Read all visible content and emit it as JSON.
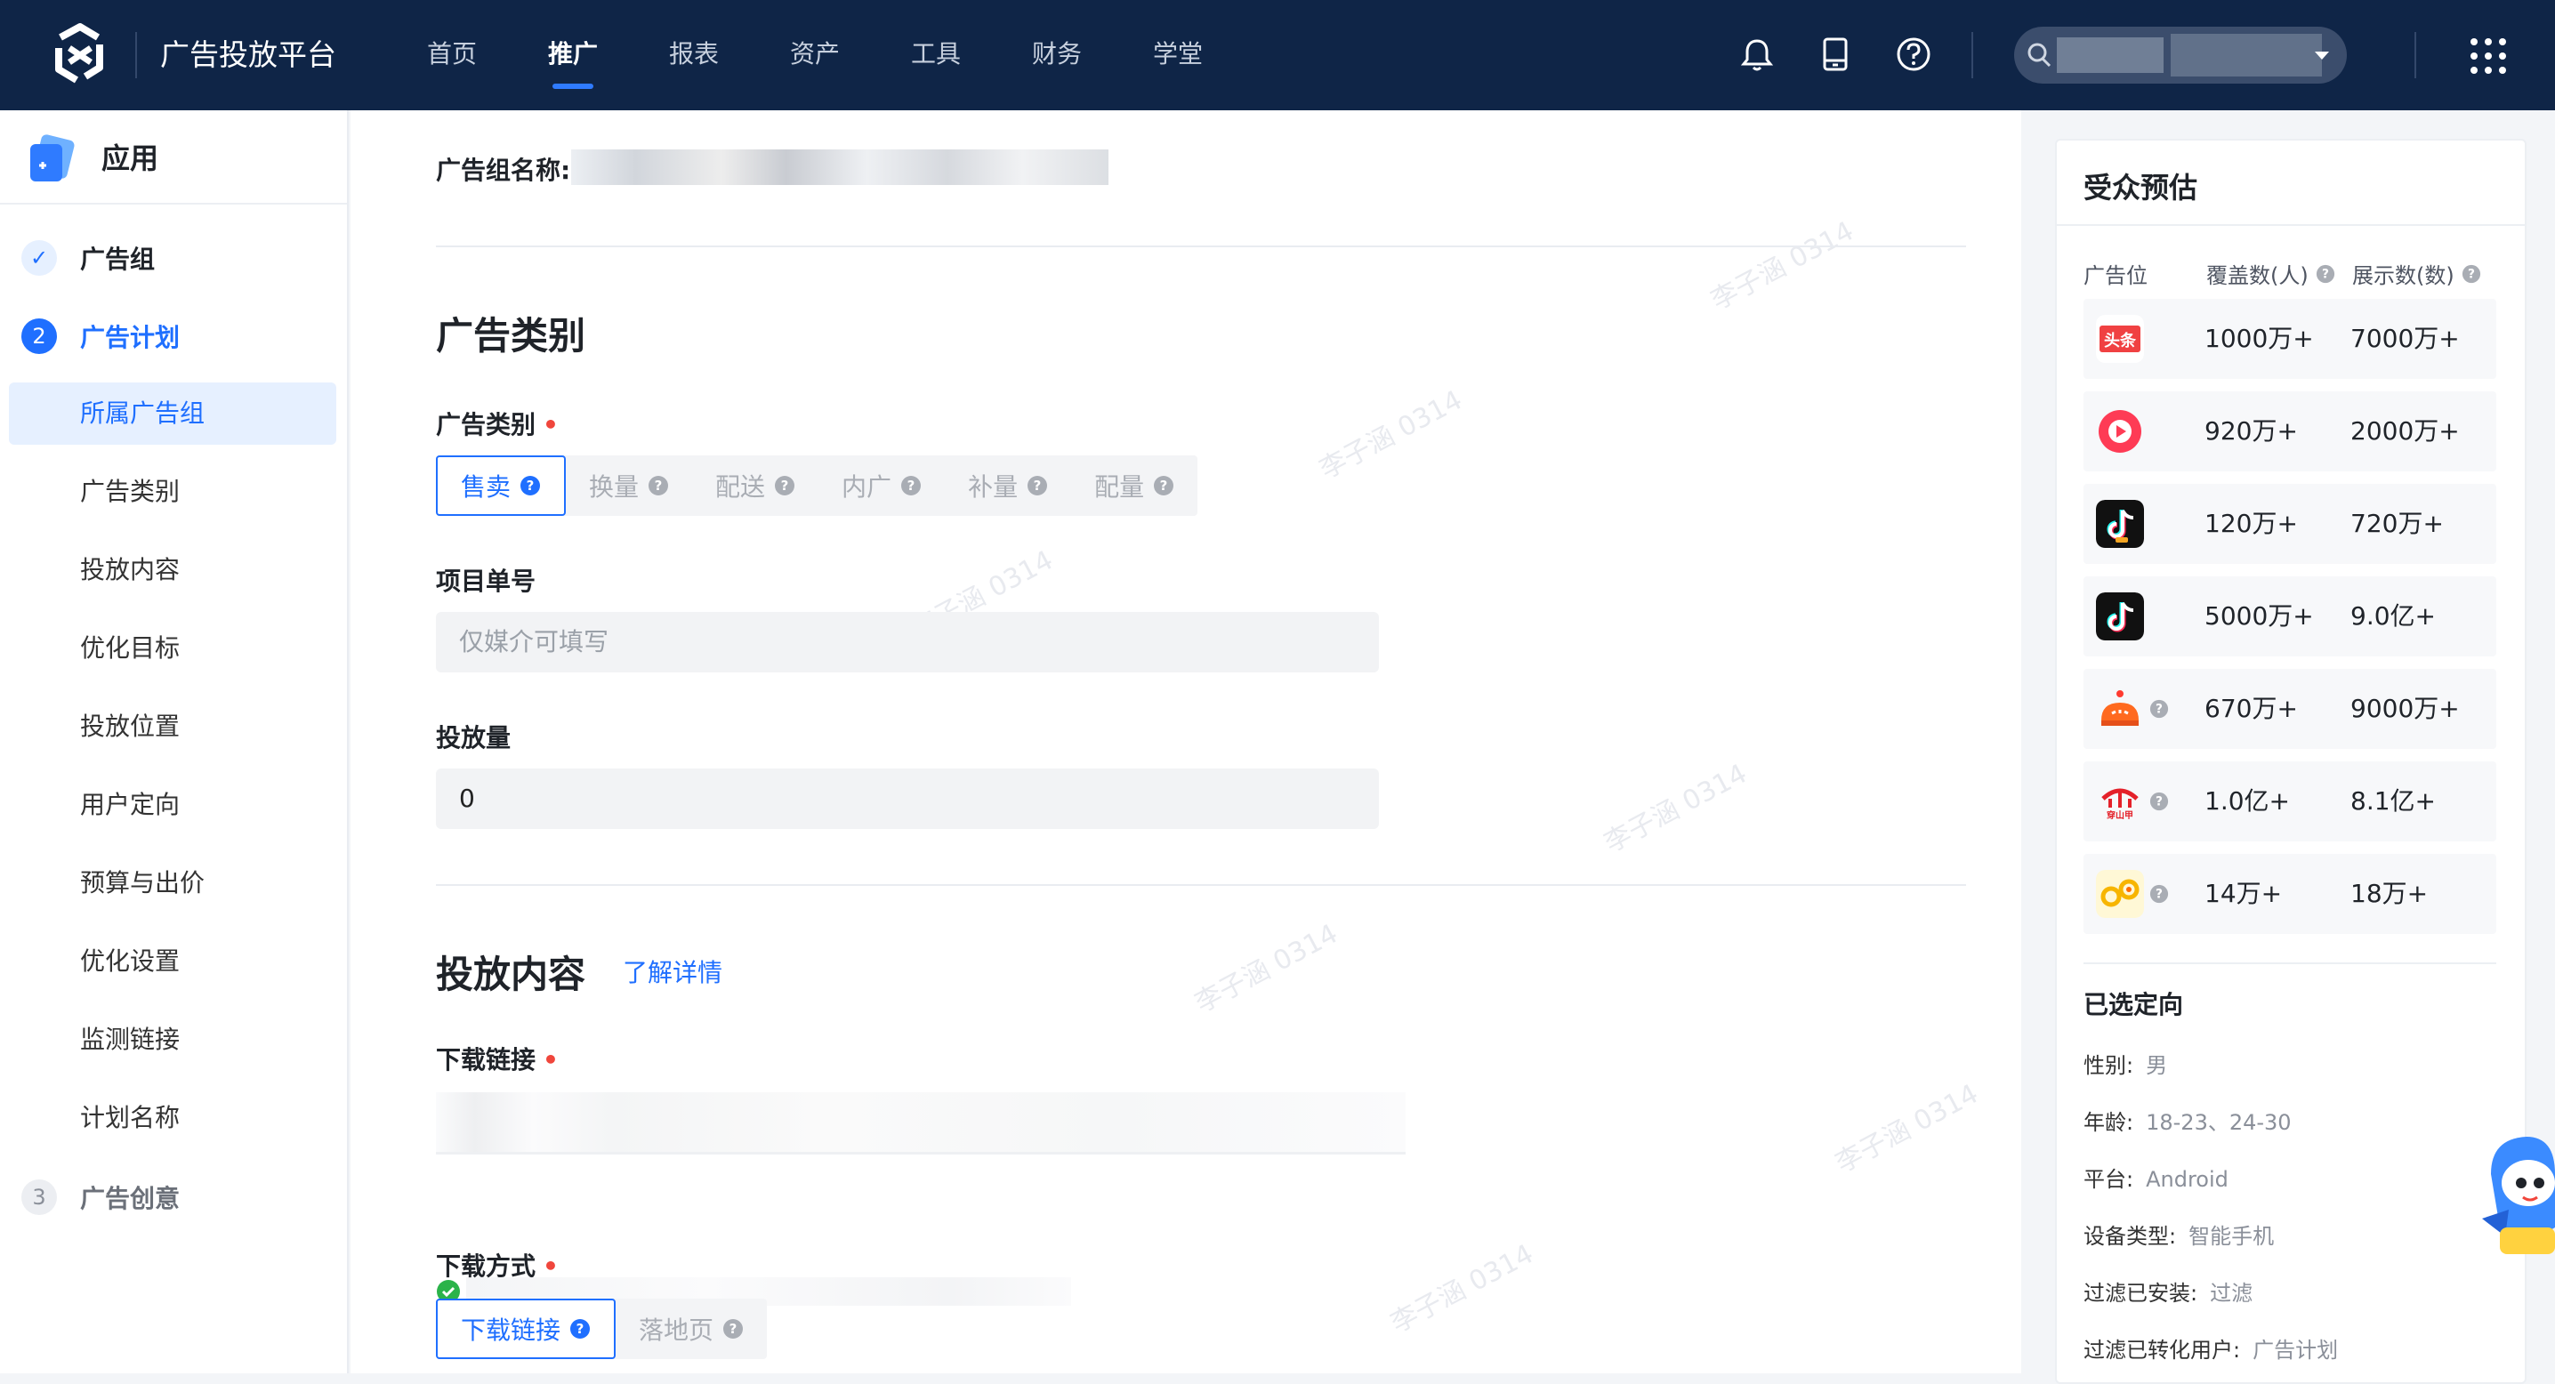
{
  "topbar": {
    "brand": "广告投放平台",
    "nav": [
      "首页",
      "推广",
      "报表",
      "资产",
      "工具",
      "财务",
      "学堂"
    ],
    "active_nav": "推广",
    "icons": [
      "bell-icon",
      "tablet-icon",
      "help-icon",
      "search-icon",
      "chevron-down-icon",
      "apps-grid-icon"
    ]
  },
  "sidebar": {
    "title": "应用",
    "steps": [
      {
        "badge": "✓",
        "label": "广告组",
        "state": "done"
      },
      {
        "badge": "2",
        "label": "广告计划",
        "state": "active"
      },
      {
        "badge": "3",
        "label": "广告创意",
        "state": "pending"
      }
    ],
    "items": [
      "所属广告组",
      "广告类别",
      "投放内容",
      "优化目标",
      "投放位置",
      "用户定向",
      "预算与出价",
      "优化设置",
      "监测链接",
      "计划名称"
    ],
    "active_item": "所属广告组"
  },
  "form": {
    "group_name_label": "广告组名称:",
    "section_category_title": "广告类别",
    "category_label": "广告类别",
    "category_options": [
      "售卖",
      "换量",
      "配送",
      "内广",
      "补量",
      "配量"
    ],
    "category_selected": "售卖",
    "project_label": "项目单号",
    "project_placeholder": "仅媒介可填写",
    "volume_label": "投放量",
    "volume_value": "0",
    "section_content_title": "投放内容",
    "learn_more": "了解详情",
    "download_link_label": "下载链接",
    "download_method_label": "下载方式",
    "download_method_options": [
      "下载链接",
      "落地页"
    ],
    "download_method_selected": "下载链接",
    "watermark": "李子涵 0314"
  },
  "audience": {
    "title": "受众预估",
    "col_media": "广告位",
    "col_cover": "覆盖数(人)",
    "col_show": "展示数(数)",
    "rows": [
      {
        "media": "头条",
        "icon": "toutiao-icon",
        "cover": "1000万+",
        "show": "7000万+"
      },
      {
        "media": "",
        "icon": "xigua-video-icon",
        "cover": "920万+",
        "show": "2000万+"
      },
      {
        "media": "",
        "icon": "douyin-icon",
        "cover": "120万+",
        "show": "720万+"
      },
      {
        "media": "",
        "icon": "douyin-lite-icon",
        "cover": "5000万+",
        "show": "9.0亿+"
      },
      {
        "media": "",
        "icon": "huoshan-icon",
        "cover": "670万+",
        "show": "9000万+"
      },
      {
        "media": "穿山甲",
        "icon": "pangle-icon",
        "cover": "1.0亿+",
        "show": "8.1亿+"
      },
      {
        "media": "",
        "icon": "jianying-icon",
        "cover": "14万+",
        "show": "18万+"
      }
    ],
    "selected_title": "已选定向",
    "selected": [
      {
        "k": "性别:",
        "v": "男"
      },
      {
        "k": "年龄:",
        "v": "18-23、24-30"
      },
      {
        "k": "平台:",
        "v": "Android"
      },
      {
        "k": "设备类型:",
        "v": "智能手机"
      },
      {
        "k": "过滤已安装:",
        "v": "过滤"
      },
      {
        "k": "过滤已转化用户:",
        "v": "广告计划"
      }
    ]
  },
  "colors": {
    "topbar": "#0f2547",
    "accent": "#1f6fff",
    "required": "#f0463c",
    "active_bg": "#e6f0ff"
  }
}
